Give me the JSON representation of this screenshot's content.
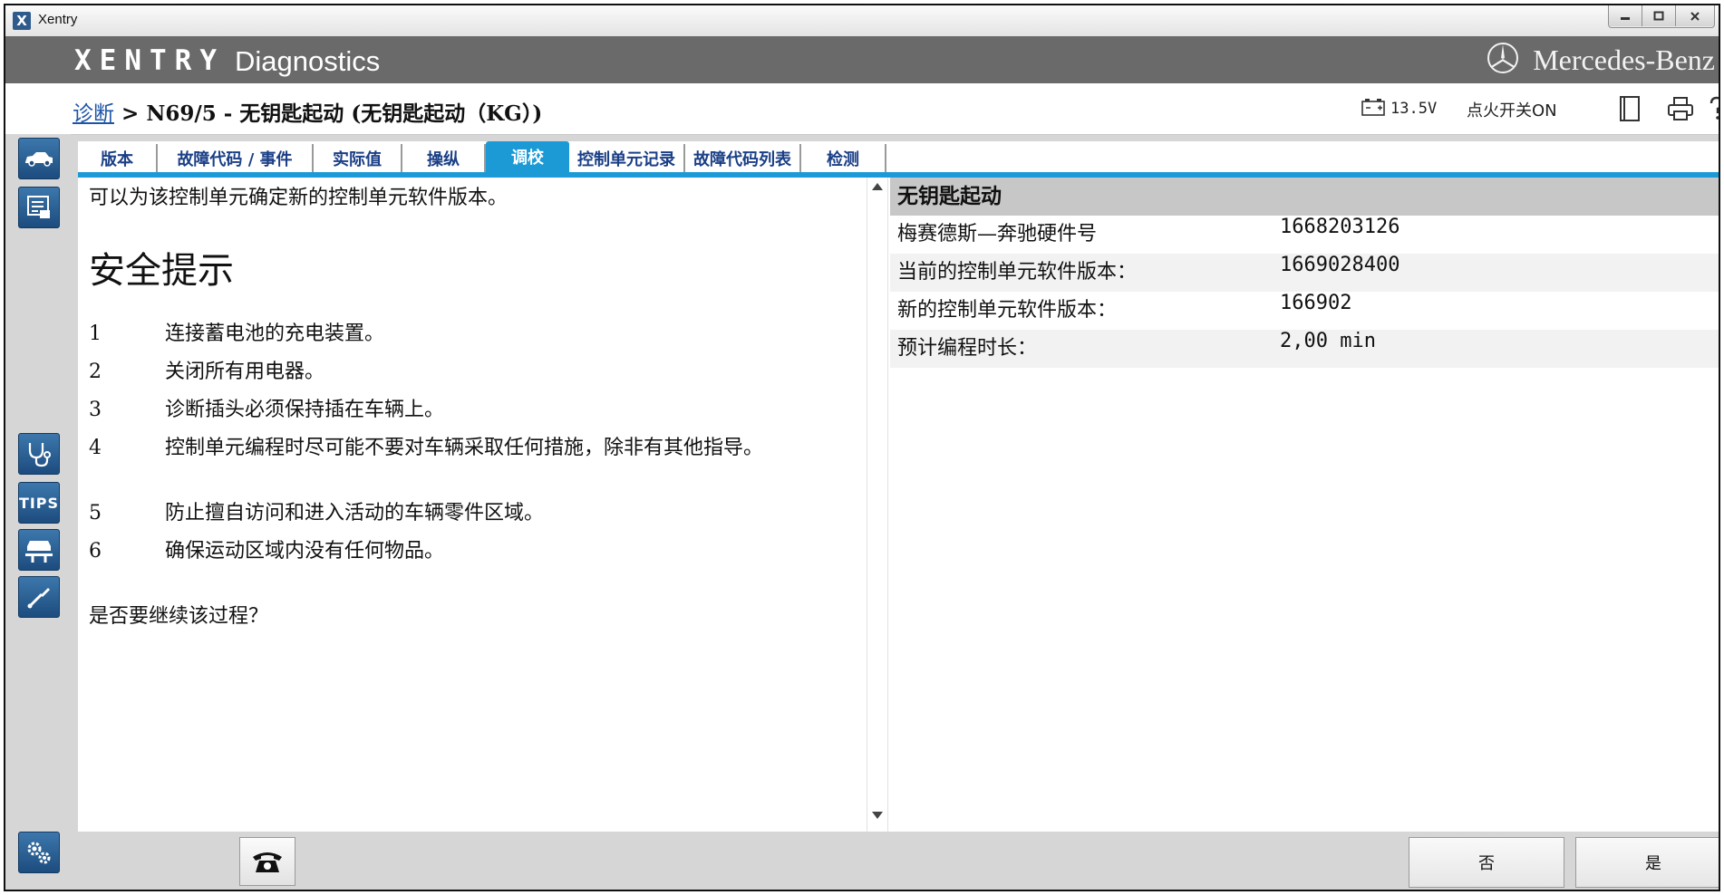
{
  "window": {
    "title": "Xentry",
    "app_icon": "X"
  },
  "header": {
    "brand": "XENTRY",
    "product": "Diagnostics",
    "maker": "Mercedes-Benz"
  },
  "status": {
    "breadcrumb_link": "诊断",
    "breadcrumb_sep": ">",
    "breadcrumb_path": "N69/5 - 无钥匙起动 (无钥匙起动（KG）)",
    "voltage": "13.5V",
    "ignition": "点火开关ON"
  },
  "sidebar": {
    "tips_label": "TIPS"
  },
  "tabs": [
    {
      "label": "版本"
    },
    {
      "label": "故障代码 / 事件"
    },
    {
      "label": "实际值"
    },
    {
      "label": "操纵"
    },
    {
      "label": "调校"
    },
    {
      "label": "控制单元记录"
    },
    {
      "label": "故障代码列表"
    },
    {
      "label": "检测"
    }
  ],
  "left": {
    "intro": "可以为该控制单元确定新的控制单元软件版本。",
    "safety_title": "安全提示",
    "steps": [
      {
        "num": "1",
        "text": "连接蓄电池的充电装置。"
      },
      {
        "num": "2",
        "text": "关闭所有用电器。"
      },
      {
        "num": "3",
        "text": "诊断插头必须保持插在车辆上。"
      },
      {
        "num": "4",
        "text": "控制单元编程时尽可能不要对车辆采取任何措施，除非有其他指导。"
      },
      {
        "num": "5",
        "text": "防止擅自访问和进入活动的车辆零件区域。"
      },
      {
        "num": "6",
        "text": "确保运动区域内没有任何物品。"
      }
    ],
    "question": "是否要继续该过程？"
  },
  "right": {
    "header": "无钥匙起动",
    "rows": [
      {
        "label": "梅赛德斯—奔驰硬件号",
        "value": "1668203126"
      },
      {
        "label": "当前的控制单元软件版本：",
        "value": "1669028400"
      },
      {
        "label": "新的控制单元软件版本：",
        "value": "166902"
      },
      {
        "label": "预计编程时长：",
        "value": "2,00 min"
      }
    ]
  },
  "buttons": {
    "no": "否",
    "yes": "是"
  },
  "colors": {
    "accent": "#1c9ad6",
    "header_bg": "#6a6a6a",
    "tab_text": "#1a3f86",
    "sidebar_btn": "#2a5f94"
  }
}
